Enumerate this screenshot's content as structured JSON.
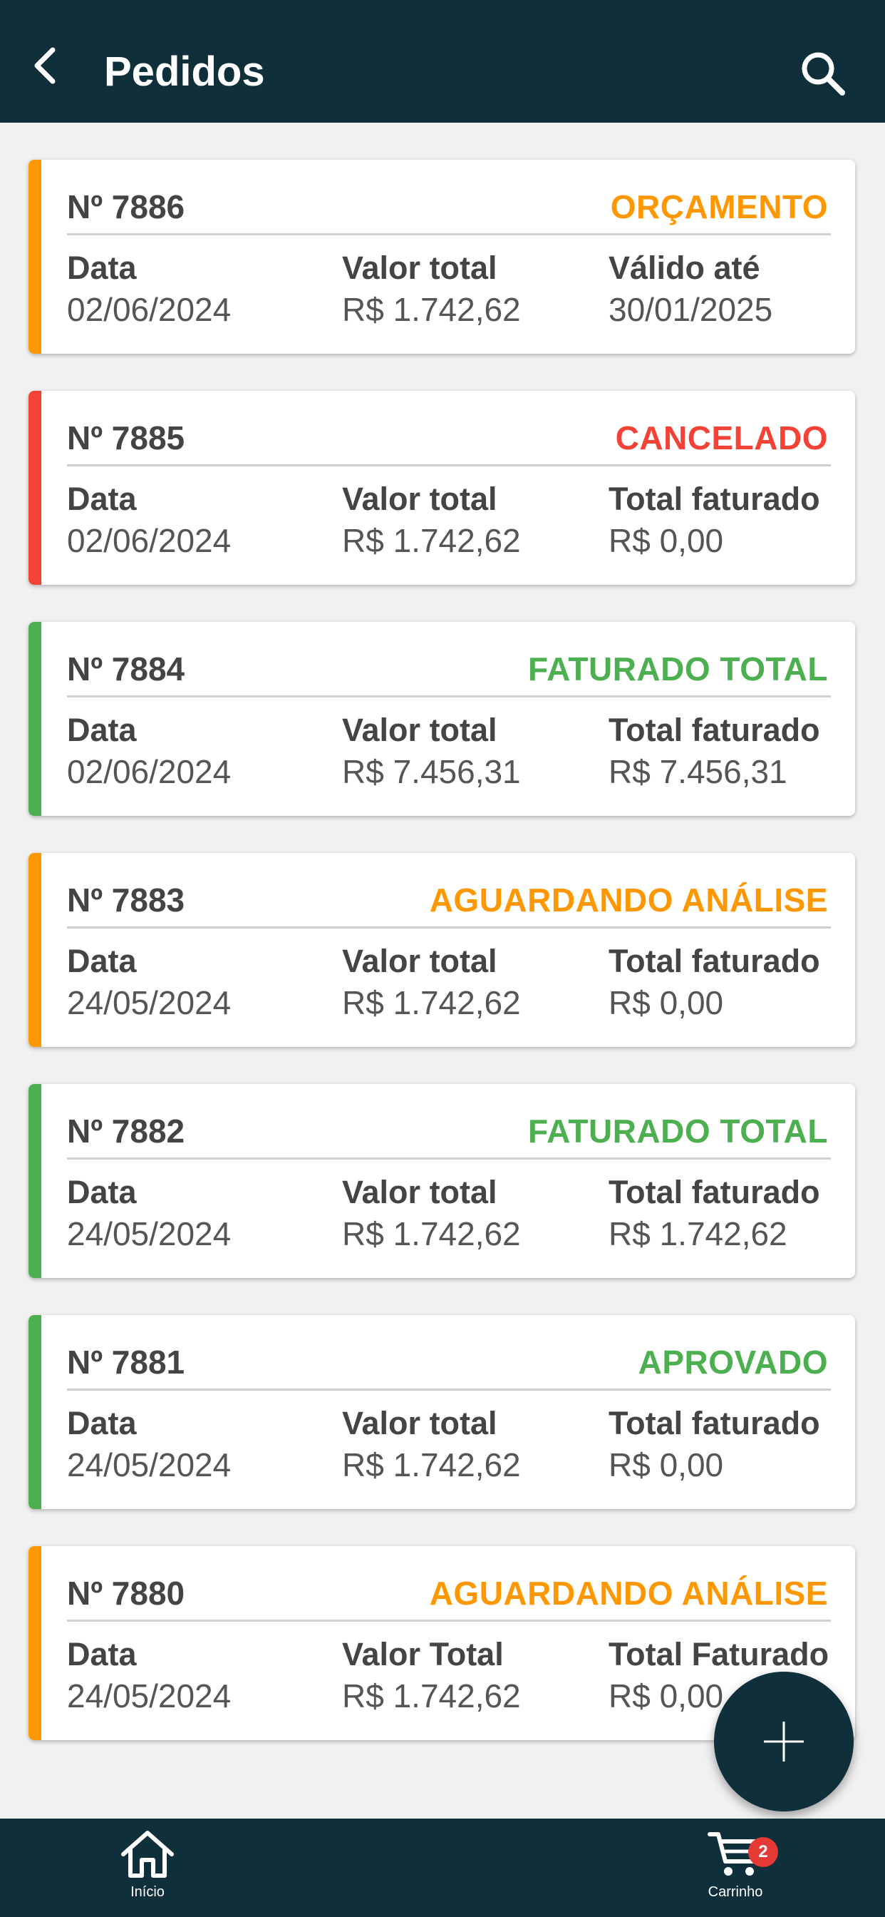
{
  "header": {
    "title": "Pedidos",
    "back_icon": "chevron-left-icon",
    "search_icon": "search-icon"
  },
  "colors": {
    "primary": "#0f2f3b",
    "orange": "#ff9800",
    "red": "#f44336",
    "green": "#4caf50"
  },
  "orders": [
    {
      "number": "Nº 7886",
      "status": "ORÇAMENTO",
      "status_color": "#ff9800",
      "col1_label": "Data",
      "col1_value": "02/06/2024",
      "col2_label": "Valor total",
      "col2_value": "R$ 1.742,62",
      "col3_label": "Válido até",
      "col3_value": "30/01/2025"
    },
    {
      "number": "Nº 7885",
      "status": "CANCELADO",
      "status_color": "#f44336",
      "col1_label": "Data",
      "col1_value": "02/06/2024",
      "col2_label": "Valor total",
      "col2_value": "R$ 1.742,62",
      "col3_label": "Total faturado",
      "col3_value": "R$ 0,00"
    },
    {
      "number": "Nº 7884",
      "status": "FATURADO TOTAL",
      "status_color": "#4caf50",
      "col1_label": "Data",
      "col1_value": "02/06/2024",
      "col2_label": "Valor total",
      "col2_value": "R$ 7.456,31",
      "col3_label": "Total faturado",
      "col3_value": "R$ 7.456,31"
    },
    {
      "number": "Nº 7883",
      "status": "AGUARDANDO ANÁLISE",
      "status_color": "#ff9800",
      "col1_label": "Data",
      "col1_value": "24/05/2024",
      "col2_label": "Valor total",
      "col2_value": "R$ 1.742,62",
      "col3_label": "Total faturado",
      "col3_value": "R$ 0,00"
    },
    {
      "number": "Nº 7882",
      "status": "FATURADO TOTAL",
      "status_color": "#4caf50",
      "col1_label": "Data",
      "col1_value": "24/05/2024",
      "col2_label": "Valor total",
      "col2_value": "R$ 1.742,62",
      "col3_label": "Total faturado",
      "col3_value": "R$ 1.742,62"
    },
    {
      "number": "Nº 7881",
      "status": "APROVADO",
      "status_color": "#4caf50",
      "col1_label": "Data",
      "col1_value": "24/05/2024",
      "col2_label": "Valor total",
      "col2_value": "R$ 1.742,62",
      "col3_label": "Total faturado",
      "col3_value": "R$ 0,00"
    },
    {
      "number": "Nº 7880",
      "status": "AGUARDANDO ANÁLISE",
      "status_color": "#ff9800",
      "col1_label": "Data",
      "col1_value": "24/05/2024",
      "col2_label": "Valor Total",
      "col2_value": "R$ 1.742,62",
      "col3_label": "Total Faturado",
      "col3_value": "R$ 0,00"
    }
  ],
  "fab": {
    "icon": "plus-icon"
  },
  "bottom_nav": {
    "home_label": "Início",
    "home_icon": "home-icon",
    "cart_label": "Carrinho",
    "cart_icon": "cart-icon",
    "cart_badge": "2"
  }
}
